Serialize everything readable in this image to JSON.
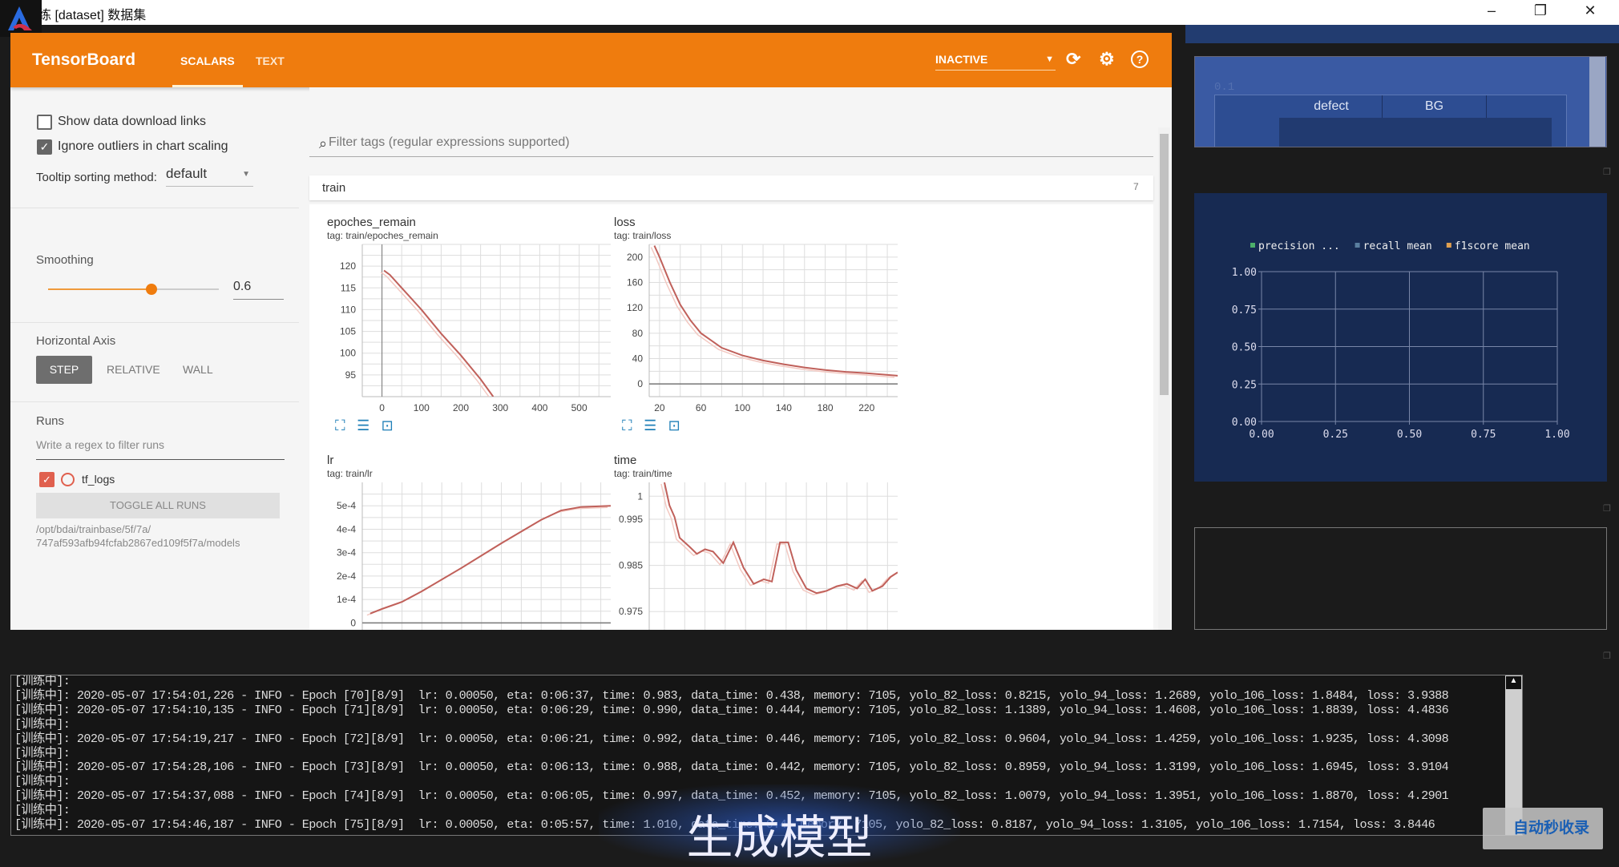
{
  "window": {
    "title": "练 [dataset] 数据集",
    "minimize": "–",
    "restore": "❐",
    "close": "✕"
  },
  "header": {
    "brand": "TensorBoard",
    "tabs": [
      {
        "label": "SCALARS",
        "active": true
      },
      {
        "label": "TEXT",
        "active": false
      }
    ],
    "status_select": "INACTIVE",
    "accent": "#ef7c0e"
  },
  "sidebar": {
    "show_download_links": {
      "label": "Show data download links",
      "checked": false
    },
    "ignore_outliers": {
      "label": "Ignore outliers in chart scaling",
      "checked": true
    },
    "tooltip_sort": {
      "label": "Tooltip sorting method:",
      "value": "default"
    },
    "smoothing": {
      "label": "Smoothing",
      "value": "0.6",
      "level": 0.6
    },
    "horizontal_axis": {
      "label": "Horizontal Axis",
      "options": [
        "STEP",
        "RELATIVE",
        "WALL"
      ],
      "selected": "STEP"
    },
    "runs": {
      "label": "Runs",
      "filter_placeholder": "Write a regex to filter runs",
      "items": [
        {
          "name": "tf_logs",
          "checked": true,
          "color": "#e0604e"
        }
      ],
      "toggle_all": "TOGGLE ALL RUNS",
      "path_line1": "/opt/bdai/trainbase/5f/7a/",
      "path_line2": "747af593afb94fcfab2867ed109f5f7a/models"
    }
  },
  "main": {
    "filter_placeholder": "Filter tags (regular expressions supported)",
    "group": {
      "name": "train",
      "count": "7"
    }
  },
  "chart_data": [
    {
      "type": "line",
      "title": "epoches_remain",
      "tag": "tag: train/epoches_remain",
      "xlim": [
        -50,
        580
      ],
      "ylim": [
        90,
        125
      ],
      "xticks": [
        0,
        100,
        200,
        300,
        400,
        500
      ],
      "yticks": [
        95,
        100,
        105,
        110,
        115,
        120
      ],
      "series": [
        {
          "x": [
            5,
            20,
            50,
            100,
            150,
            200,
            250,
            282
          ],
          "y": [
            119,
            118,
            115,
            110,
            104.5,
            99.5,
            94,
            90
          ]
        }
      ]
    },
    {
      "type": "line",
      "title": "loss",
      "tag": "tag: train/loss",
      "xlim": [
        10,
        250
      ],
      "ylim": [
        -20,
        220
      ],
      "xticks": [
        20,
        60,
        100,
        140,
        180,
        220
      ],
      "yticks": [
        0,
        40,
        80,
        120,
        160,
        200
      ],
      "series": [
        {
          "x": [
            15,
            20,
            30,
            40,
            50,
            60,
            80,
            100,
            120,
            140,
            160,
            180,
            200,
            220,
            250
          ],
          "y": [
            218,
            200,
            160,
            125,
            100,
            80,
            57,
            45,
            37,
            31,
            26,
            22,
            19,
            17,
            13
          ]
        }
      ]
    },
    {
      "type": "line",
      "title": "lr",
      "tag": "tag: train/lr",
      "xlim": [
        0,
        250
      ],
      "ylim": [
        -5e-05,
        0.0006
      ],
      "xticks": [
        20,
        60,
        100,
        140,
        180,
        220
      ],
      "yticks": [
        0,
        0.0001,
        0.0002,
        0.0003,
        0.0004,
        0.0005
      ],
      "ytick_labels": [
        "0",
        "1e-4",
        "2e-4",
        "3e-4",
        "4e-4",
        "5e-4"
      ],
      "series": [
        {
          "x": [
            8,
            20,
            40,
            60,
            100,
            140,
            180,
            200,
            220,
            250
          ],
          "y": [
            4e-05,
            6e-05,
            9e-05,
            0.000135,
            0.000235,
            0.00034,
            0.00044,
            0.00048,
            0.000495,
            0.0005
          ]
        }
      ]
    },
    {
      "type": "line",
      "title": "time",
      "tag": "tag: train/time",
      "xlim": [
        5,
        250
      ],
      "ylim": [
        0.97,
        1.003
      ],
      "xticks": [
        20,
        60,
        100,
        140,
        180,
        220
      ],
      "yticks": [
        0.975,
        0.985,
        0.995,
        1
      ],
      "ytick_labels": [
        "0.975",
        "0.985",
        "0.995",
        "1"
      ],
      "series": [
        {
          "x": [
            20,
            25,
            30,
            35,
            45,
            52,
            60,
            68,
            78,
            88,
            98,
            108,
            118,
            126,
            134,
            142,
            150,
            160,
            170,
            180,
            190,
            200,
            210,
            218,
            225,
            235,
            243,
            250
          ],
          "y": [
            1.003,
            0.998,
            0.9955,
            0.991,
            0.989,
            0.9875,
            0.9885,
            0.988,
            0.9855,
            0.99,
            0.9845,
            0.981,
            0.982,
            0.9815,
            0.99,
            0.99,
            0.984,
            0.98,
            0.979,
            0.9795,
            0.9805,
            0.981,
            0.98,
            0.982,
            0.9795,
            0.9805,
            0.9825,
            0.9835
          ]
        }
      ]
    },
    {
      "type": "line",
      "title": "",
      "legend": [
        "precision ...",
        "recall mean",
        "f1score mean"
      ],
      "legend_colors": [
        "#4caf6a",
        "#5a7f9f",
        "#e0a050"
      ],
      "xlim": [
        0,
        1
      ],
      "ylim": [
        0,
        1
      ],
      "xticks": [
        0,
        0.25,
        0.5,
        0.75,
        1
      ],
      "yticks": [
        0,
        0.25,
        0.5,
        0.75,
        1
      ],
      "xtick_labels": [
        "0.00",
        "0.25",
        "0.50",
        "0.75",
        "1.00"
      ],
      "ytick_labels": [
        "0.00",
        "0.25",
        "0.50",
        "0.75",
        "1.00"
      ],
      "series": []
    }
  ],
  "right_panel": {
    "faint_value": "0.1",
    "table_headers": [
      "defect",
      "BG"
    ]
  },
  "console": {
    "lines": [
      "[训练中]:",
      "[训练中]: 2020-05-07 17:54:01,226 - INFO - Epoch [70][8/9]  lr: 0.00050, eta: 0:06:37, time: 0.983, data_time: 0.438, memory: 7105, yolo_82_loss: 0.8215, yolo_94_loss: 1.2689, yolo_106_loss: 1.8484, loss: 3.9388",
      "[训练中]: 2020-05-07 17:54:10,135 - INFO - Epoch [71][8/9]  lr: 0.00050, eta: 0:06:29, time: 0.990, data_time: 0.444, memory: 7105, yolo_82_loss: 1.1389, yolo_94_loss: 1.4608, yolo_106_loss: 1.8839, loss: 4.4836",
      "[训练中]:",
      "[训练中]: 2020-05-07 17:54:19,217 - INFO - Epoch [72][8/9]  lr: 0.00050, eta: 0:06:21, time: 0.992, data_time: 0.446, memory: 7105, yolo_82_loss: 0.9604, yolo_94_loss: 1.4259, yolo_106_loss: 1.9235, loss: 4.3098",
      "[训练中]:",
      "[训练中]: 2020-05-07 17:54:28,106 - INFO - Epoch [73][8/9]  lr: 0.00050, eta: 0:06:13, time: 0.988, data_time: 0.442, memory: 7105, yolo_82_loss: 0.8959, yolo_94_loss: 1.3199, yolo_106_loss: 1.6945, loss: 3.9104",
      "[训练中]:",
      "[训练中]: 2020-05-07 17:54:37,088 - INFO - Epoch [74][8/9]  lr: 0.00050, eta: 0:06:05, time: 0.997, data_time: 0.452, memory: 7105, yolo_82_loss: 1.0079, yolo_94_loss: 1.3951, yolo_106_loss: 1.8870, loss: 4.2901",
      "[训练中]:",
      "[训练中]: 2020-05-07 17:54:46,187 - INFO - Epoch [75][8/9]  lr: 0.00050, eta: 0:05:57, time: 1.010, data_time: 0.4, memory: 7105, yolo_82_loss: 0.8187, yolo_94_loss: 1.3105, yolo_106_loss: 1.7154, loss: 3.8446"
    ]
  },
  "subtitle": "生成模型",
  "watermark": "自动秒收录",
  "line_color": "#c0605a"
}
